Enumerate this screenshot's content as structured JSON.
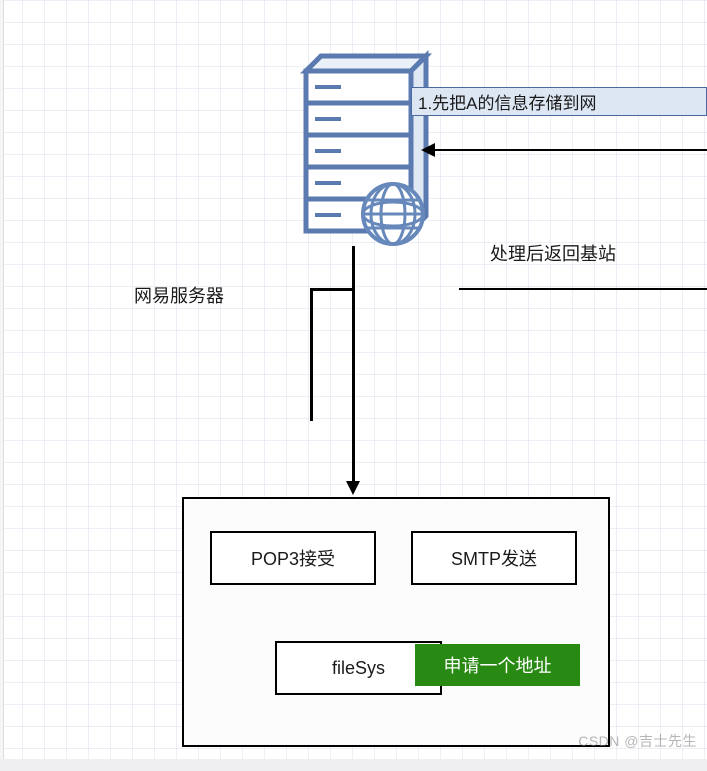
{
  "info_box": "1.先把A的信息存储到网",
  "return_label": "处理后返回基站",
  "server_label": "网易服务器",
  "container": {
    "pop3": "POP3接受",
    "smtp": "SMTP发送",
    "filesystem": "fileSys",
    "apply": "申请一个地址"
  },
  "watermark": "CSDN @吉士先生",
  "colors": {
    "info_bg": "#dde6f3",
    "info_border": "#4a6aa0",
    "apply_bg": "#288a13",
    "server_stroke": "#5b7ab0",
    "globe_stroke": "#6788bb"
  }
}
